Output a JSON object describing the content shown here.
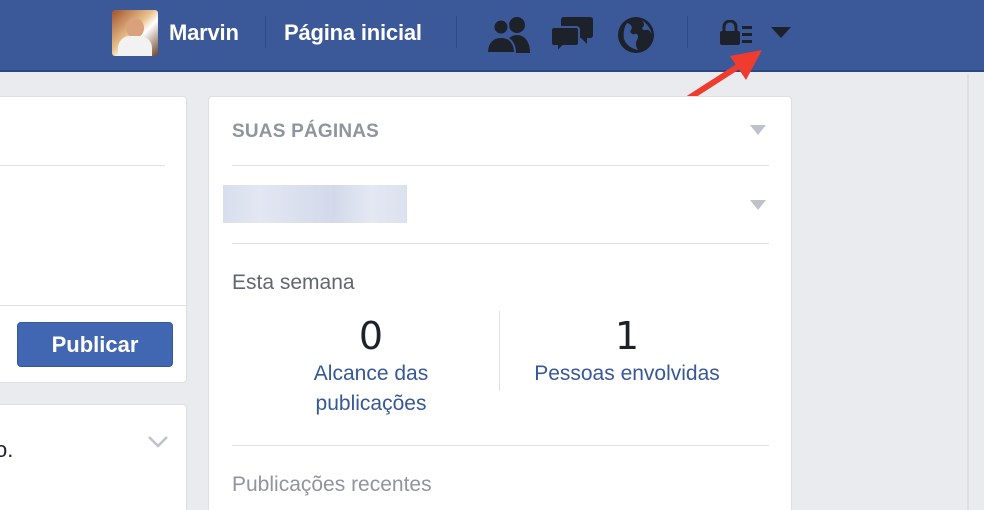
{
  "topbar": {
    "user_name": "Marvin",
    "home_label": "Página inicial",
    "icons": [
      "friends-icon",
      "messages-icon",
      "globe-icon",
      "privacy-shortcuts-icon",
      "account-menu-caret-icon"
    ],
    "bg_color": "#3b5998"
  },
  "composer": {
    "publish_label": "Publicar"
  },
  "story": {
    "snippet": "o."
  },
  "pages_panel": {
    "title": "SUAS PÁGINAS",
    "week_label": "Esta semana",
    "metrics": [
      {
        "value": "0",
        "label_line1": "Alcance das",
        "label_line2": "publicações"
      },
      {
        "value": "1",
        "label_line1": "Pessoas envolvidas",
        "label_line2": ""
      }
    ],
    "recent_label": "Publicações recentes"
  },
  "colors": {
    "accent": "#4267b2",
    "link": "#365899",
    "annotation_arrow": "#f03c2f"
  }
}
